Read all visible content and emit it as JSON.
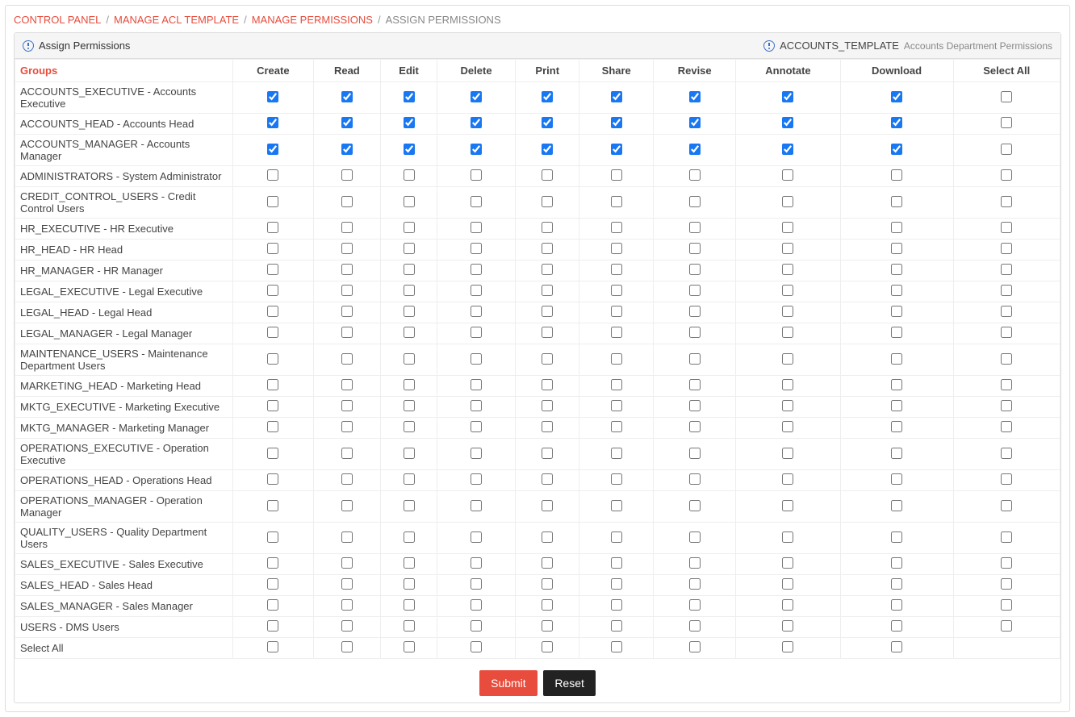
{
  "breadcrumb": {
    "items": [
      {
        "label": "CONTROL PANEL",
        "link": true
      },
      {
        "label": "MANAGE ACL TEMPLATE",
        "link": true
      },
      {
        "label": "MANAGE PERMISSIONS",
        "link": true
      },
      {
        "label": "ASSIGN PERMISSIONS",
        "link": false
      }
    ]
  },
  "panel": {
    "title": "Assign Permissions",
    "template_name": "ACCOUNTS_TEMPLATE",
    "template_desc": "Accounts Department Permissions"
  },
  "columns": [
    "Groups",
    "Create",
    "Read",
    "Edit",
    "Delete",
    "Print",
    "Share",
    "Revise",
    "Annotate",
    "Download",
    "Select All"
  ],
  "rows": [
    {
      "group": "ACCOUNTS_EXECUTIVE - Accounts Executive",
      "perms": [
        true,
        true,
        true,
        true,
        true,
        true,
        true,
        true,
        true,
        false
      ]
    },
    {
      "group": "ACCOUNTS_HEAD - Accounts Head",
      "perms": [
        true,
        true,
        true,
        true,
        true,
        true,
        true,
        true,
        true,
        false
      ]
    },
    {
      "group": "ACCOUNTS_MANAGER - Accounts Manager",
      "perms": [
        true,
        true,
        true,
        true,
        true,
        true,
        true,
        true,
        true,
        false
      ]
    },
    {
      "group": "ADMINISTRATORS - System Administrator",
      "perms": [
        false,
        false,
        false,
        false,
        false,
        false,
        false,
        false,
        false,
        false
      ]
    },
    {
      "group": "CREDIT_CONTROL_USERS - Credit Control Users",
      "perms": [
        false,
        false,
        false,
        false,
        false,
        false,
        false,
        false,
        false,
        false
      ]
    },
    {
      "group": "HR_EXECUTIVE - HR Executive",
      "perms": [
        false,
        false,
        false,
        false,
        false,
        false,
        false,
        false,
        false,
        false
      ]
    },
    {
      "group": "HR_HEAD - HR Head",
      "perms": [
        false,
        false,
        false,
        false,
        false,
        false,
        false,
        false,
        false,
        false
      ]
    },
    {
      "group": "HR_MANAGER - HR Manager",
      "perms": [
        false,
        false,
        false,
        false,
        false,
        false,
        false,
        false,
        false,
        false
      ]
    },
    {
      "group": "LEGAL_EXECUTIVE - Legal Executive",
      "perms": [
        false,
        false,
        false,
        false,
        false,
        false,
        false,
        false,
        false,
        false
      ]
    },
    {
      "group": "LEGAL_HEAD - Legal Head",
      "perms": [
        false,
        false,
        false,
        false,
        false,
        false,
        false,
        false,
        false,
        false
      ]
    },
    {
      "group": "LEGAL_MANAGER - Legal Manager",
      "perms": [
        false,
        false,
        false,
        false,
        false,
        false,
        false,
        false,
        false,
        false
      ]
    },
    {
      "group": "MAINTENANCE_USERS - Maintenance Department Users",
      "perms": [
        false,
        false,
        false,
        false,
        false,
        false,
        false,
        false,
        false,
        false
      ]
    },
    {
      "group": "MARKETING_HEAD - Marketing Head",
      "perms": [
        false,
        false,
        false,
        false,
        false,
        false,
        false,
        false,
        false,
        false
      ]
    },
    {
      "group": "MKTG_EXECUTIVE - Marketing Executive",
      "perms": [
        false,
        false,
        false,
        false,
        false,
        false,
        false,
        false,
        false,
        false
      ]
    },
    {
      "group": "MKTG_MANAGER - Marketing Manager",
      "perms": [
        false,
        false,
        false,
        false,
        false,
        false,
        false,
        false,
        false,
        false
      ]
    },
    {
      "group": "OPERATIONS_EXECUTIVE - Operation Executive",
      "perms": [
        false,
        false,
        false,
        false,
        false,
        false,
        false,
        false,
        false,
        false
      ]
    },
    {
      "group": "OPERATIONS_HEAD - Operations Head",
      "perms": [
        false,
        false,
        false,
        false,
        false,
        false,
        false,
        false,
        false,
        false
      ]
    },
    {
      "group": "OPERATIONS_MANAGER - Operation Manager",
      "perms": [
        false,
        false,
        false,
        false,
        false,
        false,
        false,
        false,
        false,
        false
      ]
    },
    {
      "group": "QUALITY_USERS - Quality Department Users",
      "perms": [
        false,
        false,
        false,
        false,
        false,
        false,
        false,
        false,
        false,
        false
      ]
    },
    {
      "group": "SALES_EXECUTIVE - Sales Executive",
      "perms": [
        false,
        false,
        false,
        false,
        false,
        false,
        false,
        false,
        false,
        false
      ]
    },
    {
      "group": "SALES_HEAD - Sales Head",
      "perms": [
        false,
        false,
        false,
        false,
        false,
        false,
        false,
        false,
        false,
        false
      ]
    },
    {
      "group": "SALES_MANAGER - Sales Manager",
      "perms": [
        false,
        false,
        false,
        false,
        false,
        false,
        false,
        false,
        false,
        false
      ]
    },
    {
      "group": "USERS - DMS Users",
      "perms": [
        false,
        false,
        false,
        false,
        false,
        false,
        false,
        false,
        false,
        false
      ]
    }
  ],
  "selectAllRow": {
    "label": "Select All",
    "perms": [
      false,
      false,
      false,
      false,
      false,
      false,
      false,
      false,
      false
    ]
  },
  "buttons": {
    "submit": "Submit",
    "reset": "Reset"
  }
}
